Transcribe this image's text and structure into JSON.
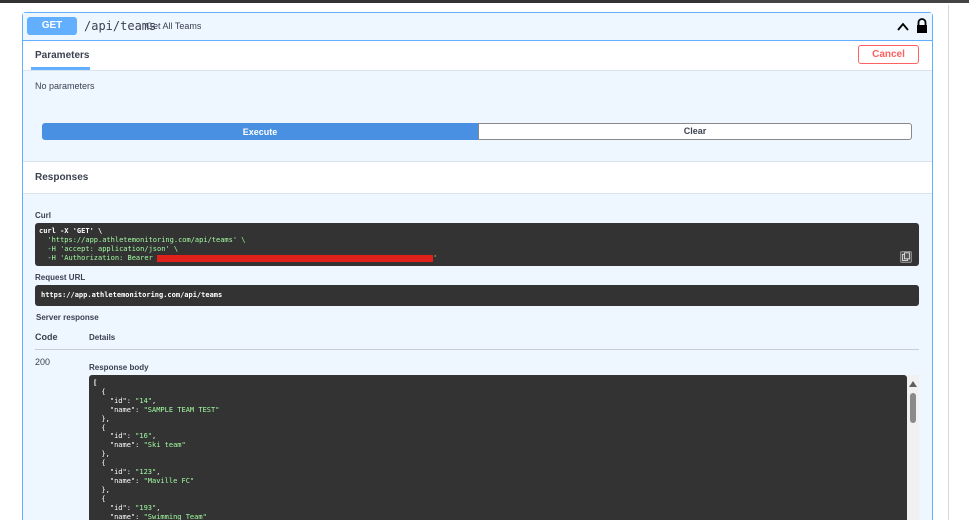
{
  "operation": {
    "method": "GET",
    "path": "/api/teams",
    "summary": "Get All Teams"
  },
  "parameters": {
    "tab_label": "Parameters",
    "cancel_label": "Cancel",
    "empty_text": "No parameters"
  },
  "actions": {
    "execute_label": "Execute",
    "clear_label": "Clear"
  },
  "responses": {
    "title": "Responses",
    "curl_label": "Curl",
    "curl_lines": [
      "curl -X 'GET' \\",
      "  'https://app.athletemonitoring.com/api/teams' \\",
      "  -H 'accept: application/json' \\",
      "  -H 'Authorization: Bearer "
    ],
    "request_url_label": "Request URL",
    "request_url": "https://app.athletemonitoring.com/api/teams",
    "server_response_label": "Server response",
    "col_code": "Code",
    "col_details": "Details",
    "status_code": "200",
    "response_body_label": "Response body",
    "response_body": [
      {
        "id": "14",
        "name": "SAMPLE TEAM TEST"
      },
      {
        "id": "16",
        "name": "Ski team"
      },
      {
        "id": "123",
        "name": "Maville FC"
      },
      {
        "id": "193",
        "name": "Swimming Team"
      }
    ]
  },
  "colors": {
    "get_method": "#61affe",
    "execute": "#4990e2",
    "cancel": "#ff6060",
    "code_bg": "#333333",
    "string": "#a2fca2",
    "redacted": "#e0201b"
  }
}
